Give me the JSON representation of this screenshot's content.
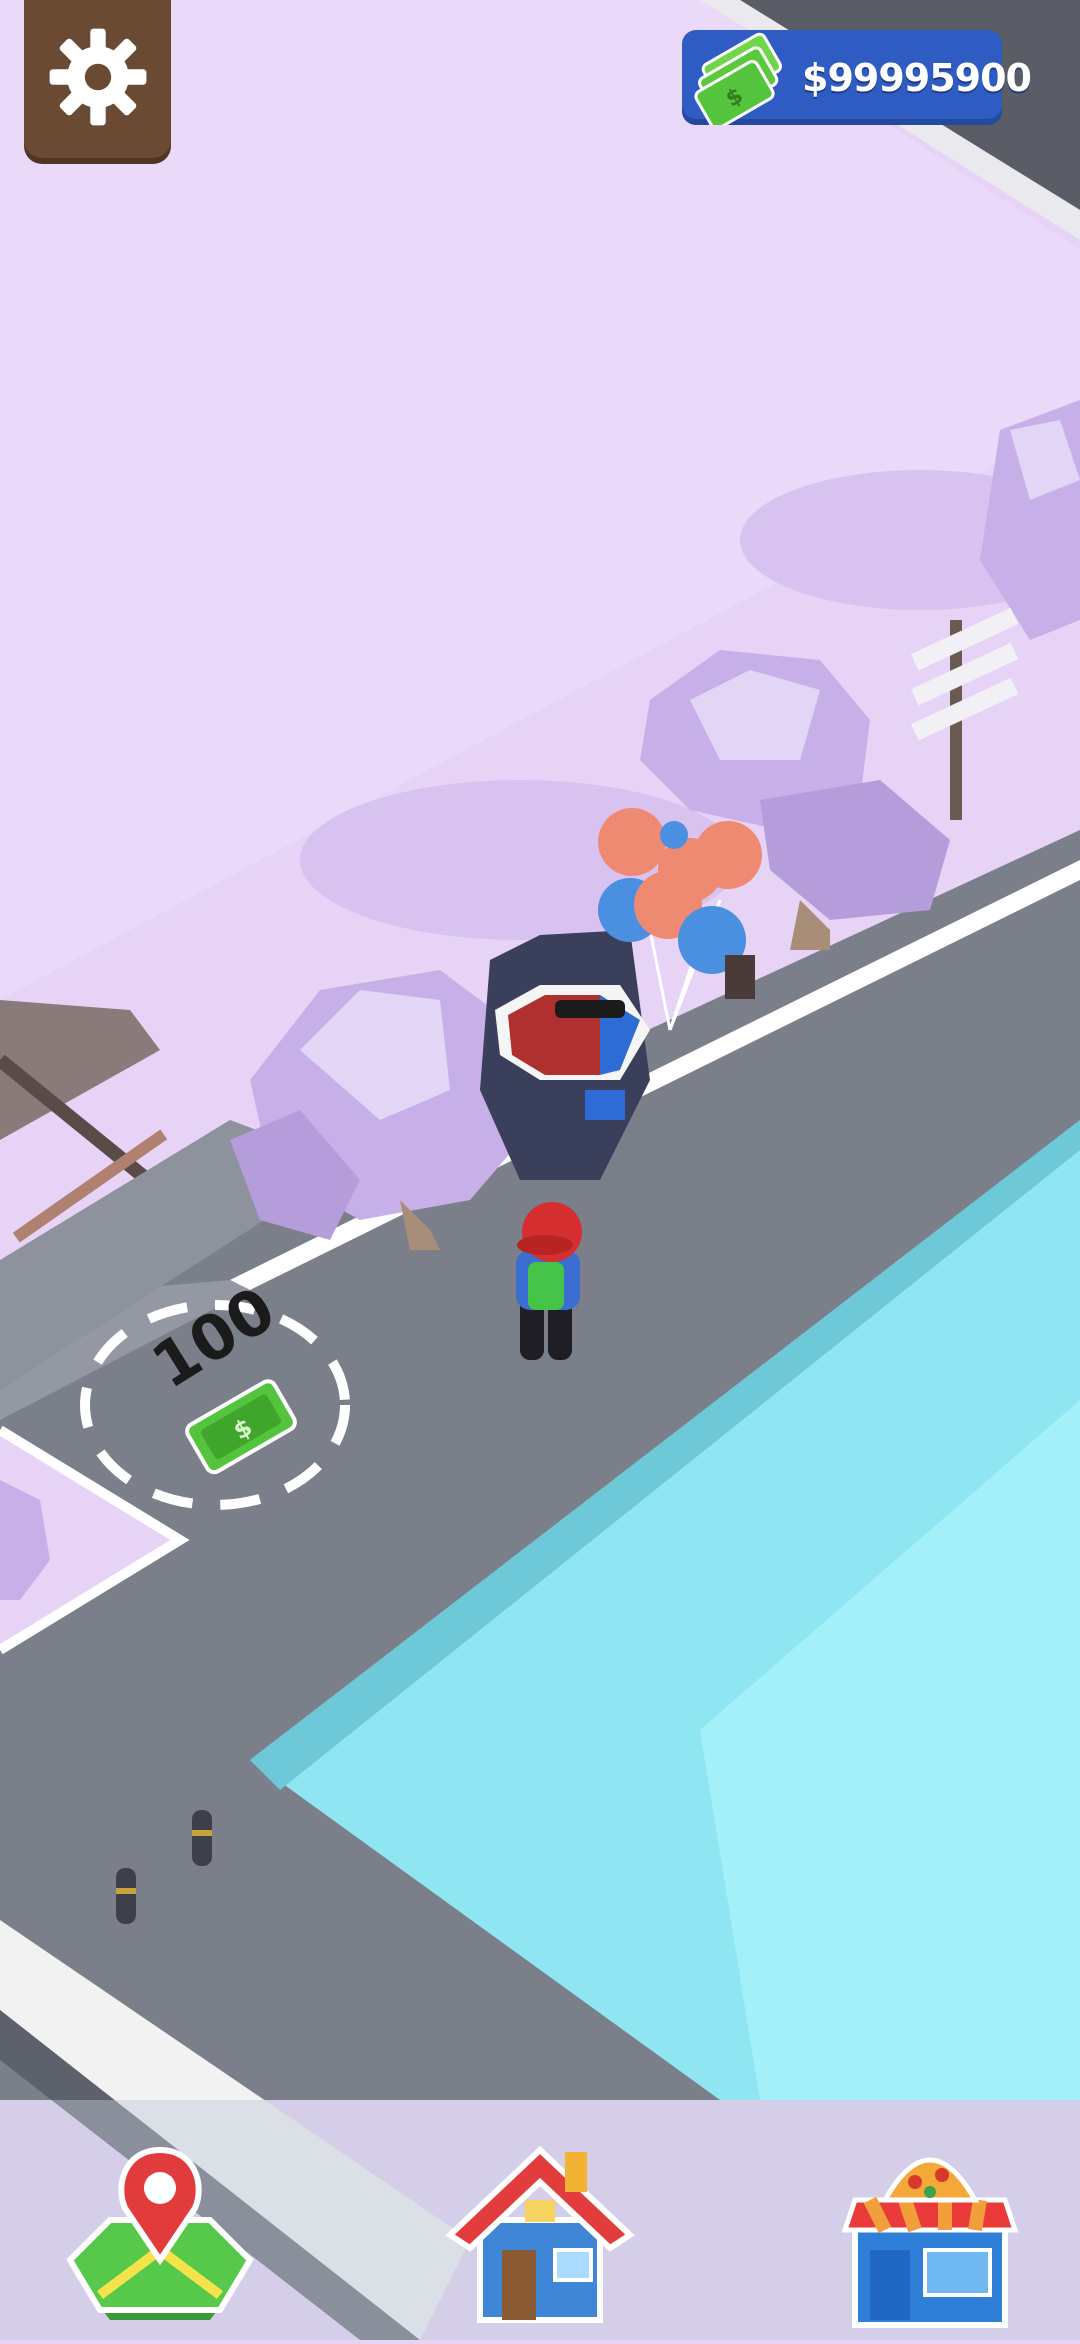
{
  "hud": {
    "settings_icon": "gear-icon",
    "money_icon": "cash-stack-icon",
    "money_label": "$99995900"
  },
  "world": {
    "purchase_zone_price": "100",
    "purchase_zone_icon": "cash-bill-icon"
  },
  "bottom_nav": {
    "items": [
      {
        "icon": "map-pin-icon"
      },
      {
        "icon": "house-icon"
      },
      {
        "icon": "pizza-shop-icon"
      }
    ]
  },
  "colors": {
    "grass": "#e6d3f6",
    "road": "#7b7f8a",
    "water": "#8fe6f2",
    "settings_bg": "#6b4a33",
    "money_bg": "#2f5cc2",
    "cash_green": "#54c43c"
  }
}
